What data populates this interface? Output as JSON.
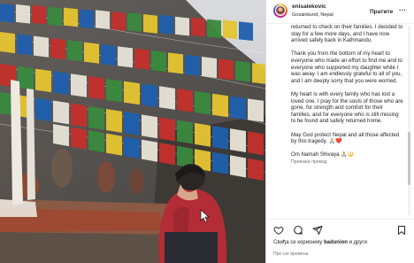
{
  "post": {
    "username": "enisalekovic",
    "location": "Gosainkund, Nepal",
    "follow_label": "Пратите",
    "more_label": "...",
    "caption_paragraphs": [
      "returned to check on their families. I decided to stay for a few more days, and I have now arrived safely back in Kathmandu.",
      "Thank you from the bottom of my heart to everyone who made an effort to find me and to everyone who supported my daughter while I was away. I am endlessly grateful to all of you, and I am deeply sorry that you were worried.",
      "My heart is with every family who has lost a loved one. I pray for the souls of those who are gone, for strength and comfort for their families, and for everyone who is still missing to be found and safely returned home.",
      "May God protect Nepal and all those affected by this tragedy. 🙏🏼❤️",
      "Om Namah Shivaya 🙏🏼🔱"
    ],
    "translate_label": "Прикажи превод",
    "likes_prefix": "Свиђа се кориснику ",
    "likes_user": "badunion",
    "likes_suffix": " и други",
    "timestamp": "Пре сат времена"
  },
  "icons": {
    "like": "heart-icon",
    "comment": "comment-icon",
    "share": "share-icon",
    "save": "bookmark-icon",
    "more": "more-horizontal-icon"
  },
  "colors": {
    "text": "#262626",
    "secondary": "#737373",
    "border": "#dbdbdb"
  }
}
